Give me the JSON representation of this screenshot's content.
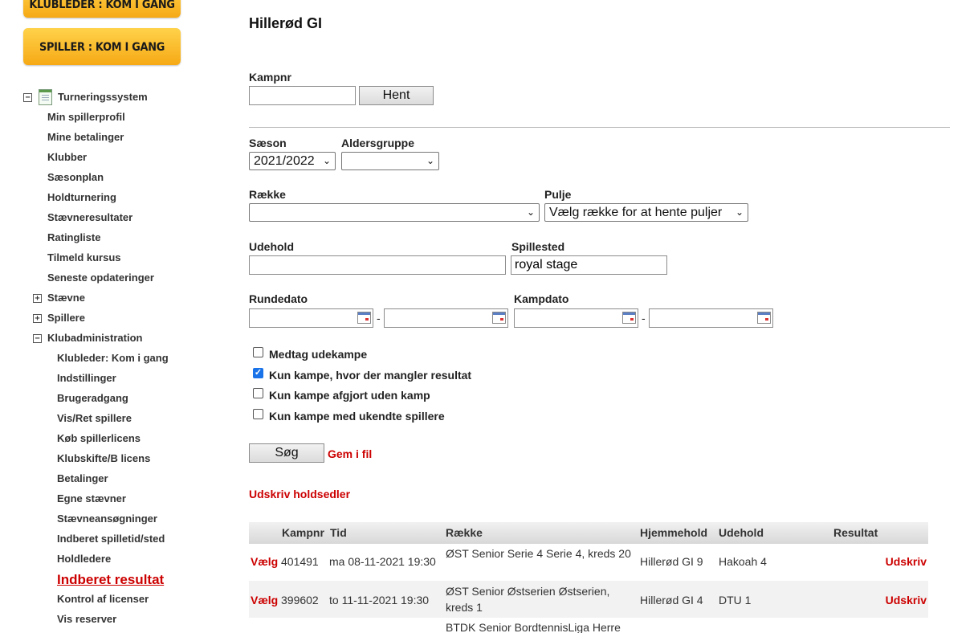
{
  "sidebar": {
    "promo_klubleder": "KLUBLEDER : KOM I GANG",
    "promo_spiller": "SPILLER : KOM I GANG",
    "root": "Turneringssystem",
    "items": [
      "Min spillerprofil",
      "Mine betalinger",
      "Klubber",
      "Sæsonplan",
      "Holdturnering",
      "Stævneresultater",
      "Ratingliste",
      "Tilmeld kursus",
      "Seneste opdateringer"
    ],
    "staevne": "Stævne",
    "spillere": "Spillere",
    "klubadmin": "Klubadministration",
    "sub": [
      "Klubleder: Kom i gang",
      "Indstillinger",
      "Brugeradgang",
      "Vis/Ret spillere",
      "Køb spillerlicens",
      "Klubskifte/B licens",
      "Betalinger",
      "Egne stævner",
      "Stævneansøgninger",
      "Indberet spilletid/sted",
      "Holdledere"
    ],
    "active": "Indberet resultat",
    "after": [
      "Kontrol af licenser",
      "Vis reserver"
    ]
  },
  "page": {
    "title": "Hillerød GI",
    "kampnr_label": "Kampnr",
    "kampnr_value": "",
    "hent": "Hent",
    "saeson_label": "Sæson",
    "saeson_value": "2021/2022",
    "aldersgruppe_label": "Aldersgruppe",
    "aldersgruppe_value": "",
    "raekke_label": "Række",
    "raekke_value": "",
    "pulje_label": "Pulje",
    "pulje_value": "Vælg række for at hente puljer",
    "udehold_label": "Udehold",
    "udehold_value": "",
    "spillested_label": "Spillested",
    "spillested_value": "royal stage",
    "rundedato_label": "Rundedato",
    "kampdato_label": "Kampdato",
    "dash": "-",
    "cb_udekampe": "Medtag udekampe",
    "cb_mangler": "Kun kampe, hvor der mangler resultat",
    "cb_afgjort": "Kun kampe afgjort uden kamp",
    "cb_ukendte": "Kun kampe med ukendte spillere",
    "checked": "✓",
    "soeg": "Søg",
    "gem": "Gem i fil",
    "udskriv_holdsedler": "Udskriv holdsedler"
  },
  "table": {
    "headers": {
      "kampnr": "Kampnr",
      "tid": "Tid",
      "raekke": "Række",
      "hjemmehold": "Hjemmehold",
      "udehold": "Udehold",
      "resultat": "Resultat"
    },
    "vaelg": "Vælg",
    "udskriv": "Udskriv",
    "rows": [
      {
        "kampnr": "401491",
        "tid": "ma 08-11-2021 19:30",
        "raekke": "ØST Senior Serie 4 Serie 4, kreds 20",
        "hjemme": "Hillerød GI 9",
        "ude": "Hakoah 4"
      },
      {
        "kampnr": "399602",
        "tid": "to 11-11-2021 19:30",
        "raekke": "ØST Senior Østserien Østserien, kreds 1",
        "hjemme": "Hillerød GI 4",
        "ude": "DTU 1"
      },
      {
        "kampnr": "",
        "tid": "",
        "raekke": "BTDK Senior BordtennisLiga Herre",
        "hjemme": "",
        "ude": ""
      }
    ]
  }
}
